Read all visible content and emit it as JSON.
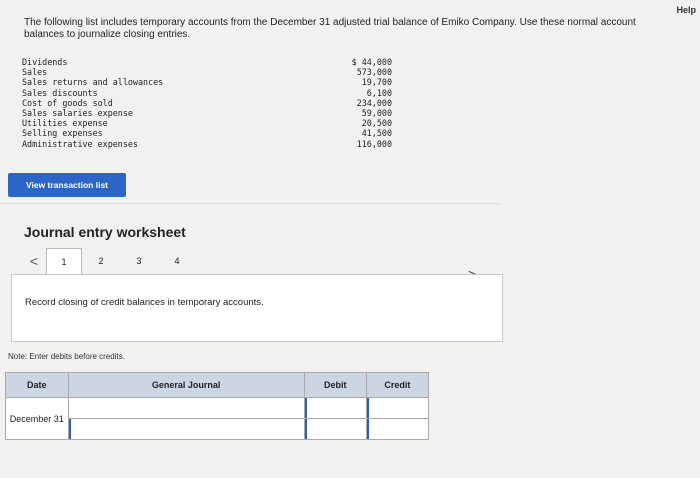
{
  "help_label": "Help",
  "intro": "The following list includes temporary accounts from the December 31 adjusted trial balance of Emiko Company. Use these normal account balances to journalize closing entries.",
  "accounts": [
    {
      "name": "Dividends",
      "amount": "$ 44,000"
    },
    {
      "name": "Sales",
      "amount": "573,000"
    },
    {
      "name": "Sales returns and allowances",
      "amount": "19,700"
    },
    {
      "name": "Sales discounts",
      "amount": "6,100"
    },
    {
      "name": "Cost of goods sold",
      "amount": "234,000"
    },
    {
      "name": "Sales salaries expense",
      "amount": "59,000"
    },
    {
      "name": "Utilities expense",
      "amount": "20,500"
    },
    {
      "name": "Selling expenses",
      "amount": "41,500"
    },
    {
      "name": "Administrative expenses",
      "amount": "116,000"
    }
  ],
  "view_button": "View transaction list",
  "worksheet": {
    "title": "Journal entry worksheet",
    "prev_arrow": "<",
    "next_arrow": ">",
    "pages": [
      "1",
      "2",
      "3",
      "4"
    ],
    "instruction": "Record closing of credit balances in temporary accounts.",
    "note": "Note: Enter debits before credits.",
    "table": {
      "headers": {
        "date": "Date",
        "journal": "General Journal",
        "debit": "Debit",
        "credit": "Credit"
      },
      "date_value": "December 31"
    }
  }
}
